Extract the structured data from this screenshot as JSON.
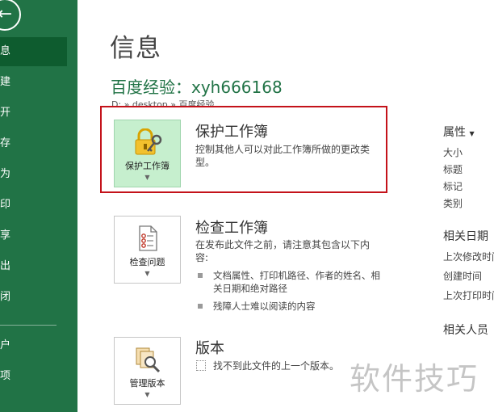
{
  "nav": {
    "items": [
      {
        "label": "信息",
        "active": true
      },
      {
        "label": "新建"
      },
      {
        "label": "打开"
      },
      {
        "label": "保存"
      },
      {
        "label": "另存为"
      },
      {
        "label": "打印"
      },
      {
        "label": "共享"
      },
      {
        "label": "导出"
      },
      {
        "label": "关闭"
      },
      {
        "label": "账户"
      },
      {
        "label": "选项"
      }
    ]
  },
  "page_title": "信息",
  "doc": {
    "name": "百度经验：xyh666168",
    "path": "D: » desktop » 百度经验"
  },
  "protect": {
    "tile_label": "保护工作簿",
    "title": "保护工作簿",
    "desc": "控制其他人可以对此工作簿所做的更改类型。"
  },
  "inspect": {
    "tile_label": "检查问题",
    "title": "检查工作簿",
    "desc": "在发布此文件之前，请注意其包含以下内容:",
    "bullets": [
      "文档属性、打印机路径、作者的姓名、相关日期和绝对路径",
      "残障人士难以阅读的内容"
    ]
  },
  "versions": {
    "tile_label": "管理版本",
    "title": "版本",
    "desc": "找不到此文件的上一个版本。"
  },
  "properties": {
    "head": "属性",
    "items": [
      "大小",
      "标题",
      "标记",
      "类别"
    ],
    "dates_head": "相关日期",
    "dates": [
      "上次修改时间",
      "创建时间",
      "上次打印时间"
    ],
    "people_head": "相关人员"
  },
  "watermark": "软件技巧",
  "colors": {
    "brand_green": "#217346",
    "highlight_red": "#c4121a"
  }
}
